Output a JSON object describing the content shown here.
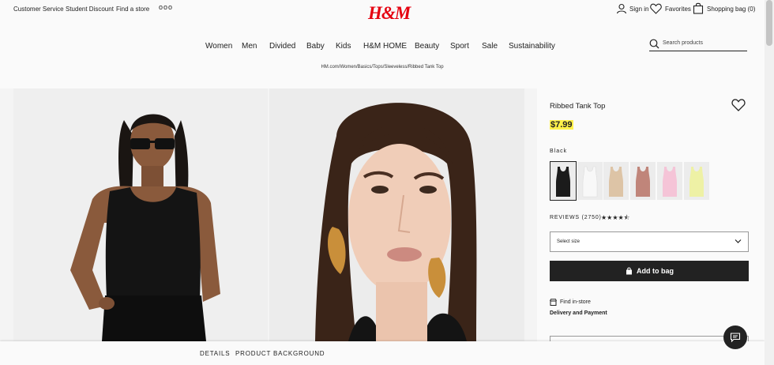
{
  "header": {
    "utility_links": [
      "Customer Service",
      "Student Discount",
      "Find a store"
    ],
    "more": "ooo",
    "logo": "H&M",
    "sign_in": "Sign in",
    "favorites": "Favorites",
    "shopping_bag": "Shopping bag (0)",
    "nav": [
      "Women",
      "Men",
      "Divided",
      "Baby",
      "Kids",
      "H&M HOME",
      "Beauty",
      "Sport",
      "Sale",
      "Sustainability"
    ],
    "search_placeholder": "Search products"
  },
  "breadcrumb": "HM.com/Women/Basics/Tops/Sleeveless/Ribbed Tank Top",
  "product": {
    "title": "Ribbed Tank Top",
    "price": "$7.99",
    "color_label": "Black",
    "swatch_colors": [
      "#1b1b1b",
      "#f4f4f4",
      "#ddc4a6",
      "#c0857a",
      "#f5c4d7",
      "#eef1a5"
    ],
    "reviews_label": "REVIEWS (2750)",
    "rating": 4.5,
    "stars": "★★★★⯪",
    "select_size": "Select size",
    "add_to_bag": "Add to bag",
    "find_in_store": "Find in-store",
    "delivery": "Delivery and Payment"
  },
  "bottom_tabs": [
    "DETAILS",
    "PRODUCT BACKGROUND"
  ],
  "icons": [
    "user-icon",
    "heart-icon",
    "bag-icon",
    "search-icon",
    "chevron-down-icon",
    "lock-bag-icon",
    "store-icon",
    "chat-icon"
  ],
  "colors": {
    "brand": "#e50010",
    "price_highlight": "#fff14a",
    "button": "#222222"
  }
}
